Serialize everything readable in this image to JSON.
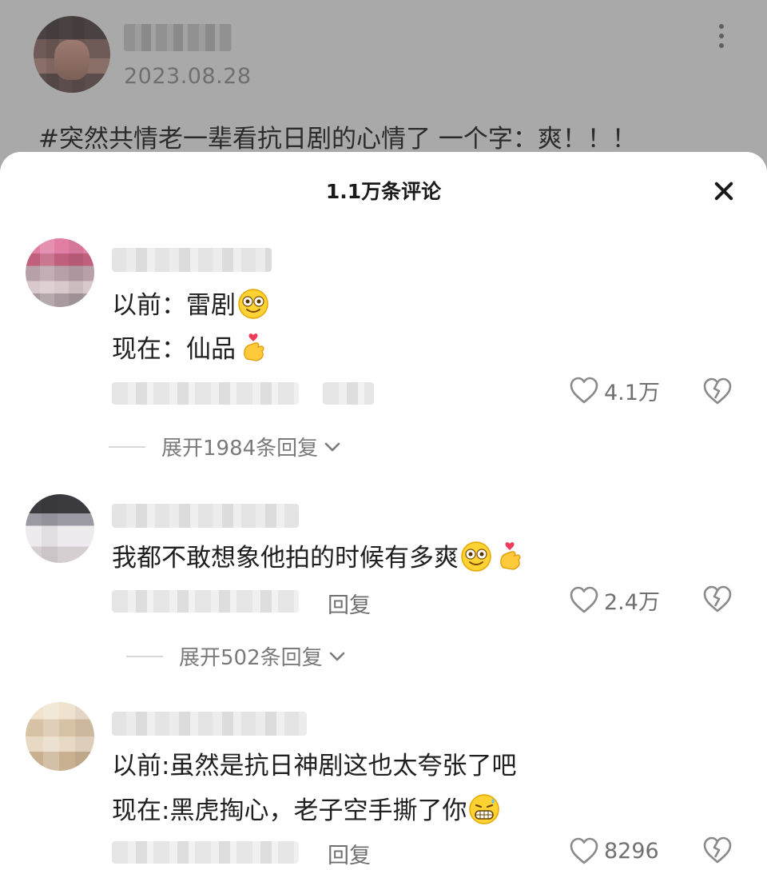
{
  "post": {
    "date": "2023.08.28",
    "text": "#突然共情老一辈看抗日剧的心情了 一个字：爽！！！"
  },
  "sheet": {
    "title": "1.1万条评论"
  },
  "comments": [
    {
      "lines": [
        "以前：雷剧",
        "现在：仙品"
      ],
      "emojis": [
        "dizzy-smile-emoji",
        "finger-heart-emoji"
      ],
      "likes": "4.1万",
      "expand_label": "展开1984条回复"
    },
    {
      "lines": [
        "我都不敢想象他拍的时候有多爽"
      ],
      "emojis": [
        "dizzy-smile-emoji",
        "finger-heart-emoji"
      ],
      "reply_label": "回复",
      "likes": "2.4万",
      "expand_label": "展开502条回复"
    },
    {
      "lines": [
        "以前:虽然是抗日神剧这也太夸张了吧",
        "现在:黑虎掏心，老子空手撕了你"
      ],
      "emojis": [
        "grin-sweat-emoji"
      ],
      "reply_label": "回复",
      "likes": "8296"
    }
  ],
  "icons": [
    "more-vertical-icon",
    "close-icon",
    "heart-outline-icon",
    "broken-heart-icon",
    "chevron-down-icon"
  ],
  "colors": {
    "overlay_bg": "#ababab",
    "sheet_bg": "#ffffff",
    "text_primary": "#1f1f1f",
    "text_secondary": "#707070"
  }
}
